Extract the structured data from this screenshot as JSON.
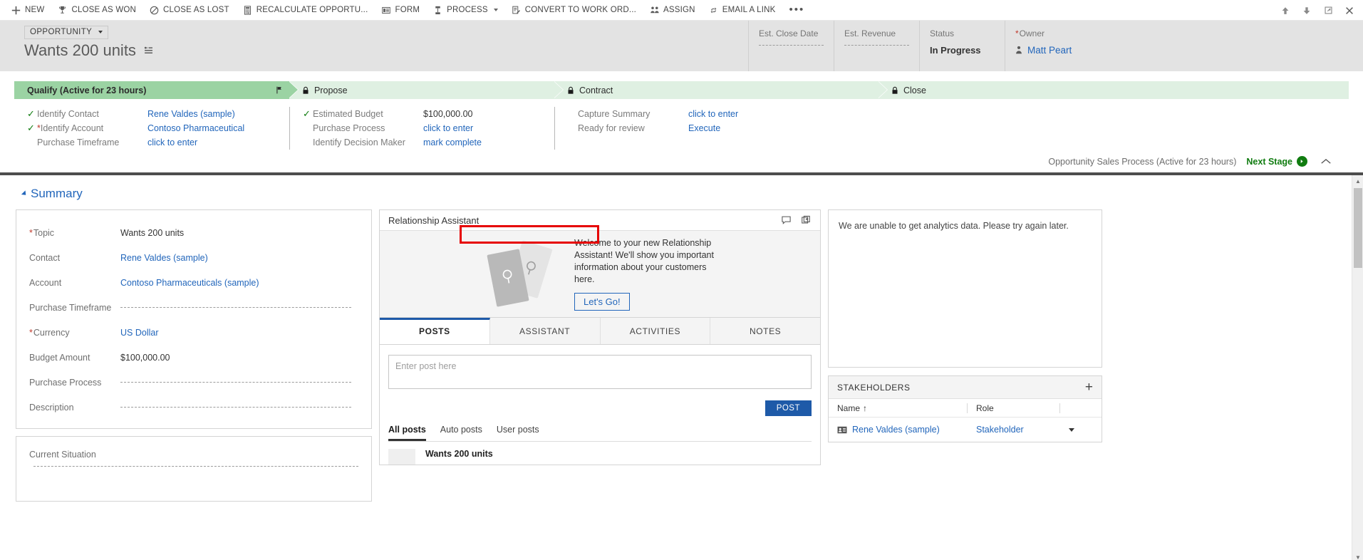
{
  "commandbar": {
    "items": [
      {
        "label": "NEW",
        "icon": "plus-icon"
      },
      {
        "label": "CLOSE AS WON",
        "icon": "trophy-icon"
      },
      {
        "label": "CLOSE AS LOST",
        "icon": "prohibited-icon"
      },
      {
        "label": "RECALCULATE OPPORTU...",
        "icon": "calculator-icon"
      },
      {
        "label": "FORM",
        "icon": "form-icon"
      },
      {
        "label": "PROCESS",
        "icon": "process-icon",
        "caret": true
      },
      {
        "label": "CONVERT TO WORK ORD...",
        "icon": "work-order-icon"
      },
      {
        "label": "ASSIGN",
        "icon": "assign-users-icon"
      },
      {
        "label": "EMAIL A LINK",
        "icon": "link-icon"
      }
    ],
    "overflow": "•••",
    "window_buttons": [
      "up-arrow-icon",
      "down-arrow-icon",
      "popout-icon",
      "close-icon"
    ]
  },
  "header": {
    "entity_type": "OPPORTUNITY",
    "record_title": "Wants 200 units",
    "fields": [
      {
        "label": "Est. Close Date",
        "value": "",
        "required": false,
        "empty": true
      },
      {
        "label": "Est. Revenue",
        "value": "",
        "required": false,
        "empty": true
      },
      {
        "label": "Status",
        "value": "In Progress",
        "required": false,
        "empty": false
      },
      {
        "label": "Owner",
        "value": "Matt Peart",
        "required": true,
        "empty": false,
        "is_link": true
      }
    ]
  },
  "process": {
    "stages": [
      {
        "label": "Qualify (Active for 23 hours)",
        "state": "active",
        "locked": false
      },
      {
        "label": "Propose",
        "state": "inactive",
        "locked": true
      },
      {
        "label": "Contract",
        "state": "inactive",
        "locked": true
      },
      {
        "label": "Close",
        "state": "inactive",
        "locked": true
      }
    ],
    "columns": [
      {
        "rows": [
          {
            "check": "✓",
            "label": "Identify Contact",
            "required": false,
            "value": "Rene Valdes (sample)",
            "link": true
          },
          {
            "check": "✓",
            "label": "Identify Account",
            "required": true,
            "value": "Contoso Pharmaceutical",
            "link": true
          },
          {
            "check": "",
            "label": "Purchase Timeframe",
            "required": false,
            "value": "click to enter",
            "link": true
          }
        ]
      },
      {
        "rows": [
          {
            "check": "✓",
            "label": "Estimated Budget",
            "required": false,
            "value": "$100,000.00",
            "link": false
          },
          {
            "check": "",
            "label": "Purchase Process",
            "required": false,
            "value": "click to enter",
            "link": true
          },
          {
            "check": "",
            "label": "Identify Decision Maker",
            "required": false,
            "value": "mark complete",
            "link": true
          }
        ]
      },
      {
        "rows": [
          {
            "check": "",
            "label": "Capture Summary",
            "required": false,
            "value": "click to enter",
            "link": true
          },
          {
            "check": "",
            "label": "Ready for review",
            "required": false,
            "value": "Execute",
            "link": true,
            "highlighted": true
          }
        ]
      }
    ],
    "footer": {
      "process_name": "Opportunity Sales Process (Active for 23 hours)",
      "next_stage_label": "Next Stage",
      "collapse_icon": "chevron-up-icon"
    },
    "highlight_color": "#e60000"
  },
  "summary": {
    "section_label": "Summary",
    "fields": [
      {
        "label": "Topic",
        "required": true,
        "value": "Wants 200 units",
        "link": false,
        "empty": false
      },
      {
        "label": "Contact",
        "required": false,
        "value": "Rene Valdes (sample)",
        "link": true,
        "empty": false
      },
      {
        "label": "Account",
        "required": false,
        "value": "Contoso Pharmaceuticals (sample)",
        "link": true,
        "empty": false
      },
      {
        "label": "Purchase Timeframe",
        "required": false,
        "value": "",
        "link": false,
        "empty": true
      },
      {
        "label": "Currency",
        "required": true,
        "value": "US Dollar",
        "link": true,
        "empty": false
      },
      {
        "label": "Budget Amount",
        "required": false,
        "value": "$100,000.00",
        "link": false,
        "empty": false
      },
      {
        "label": "Purchase Process",
        "required": false,
        "value": "",
        "link": false,
        "empty": true
      },
      {
        "label": "Description",
        "required": false,
        "value": "",
        "link": false,
        "empty": true
      }
    ],
    "current_situation_label": "Current Situation"
  },
  "relationship_assistant": {
    "title": "Relationship Assistant",
    "header_icons": [
      "feedback-icon",
      "cards-icon"
    ],
    "welcome_text": "Welcome to your new Relationship Assistant! We'll show you important information about your customers here.",
    "cta_label": "Let's Go!"
  },
  "social_pane": {
    "tabs": [
      {
        "label": "POSTS",
        "active": true
      },
      {
        "label": "ASSISTANT",
        "active": false
      },
      {
        "label": "ACTIVITIES",
        "active": false
      },
      {
        "label": "NOTES",
        "active": false
      }
    ],
    "post_placeholder": "Enter post here",
    "post_value": "",
    "post_button": "POST",
    "filters": [
      {
        "label": "All posts",
        "active": true
      },
      {
        "label": "Auto posts",
        "active": false
      },
      {
        "label": "User posts",
        "active": false
      }
    ],
    "posts": [
      {
        "subject": "Wants 200 units"
      }
    ]
  },
  "analytics": {
    "message": "We are unable to get analytics data. Please try again later."
  },
  "stakeholders": {
    "title": "STAKEHOLDERS",
    "add_icon": "plus-icon",
    "columns": [
      "Name",
      "Role",
      ""
    ],
    "sort_column": "Name",
    "sort_indicator": "↑",
    "rows": [
      {
        "name": "Rene Valdes (sample)",
        "role": "Stakeholder"
      }
    ]
  }
}
